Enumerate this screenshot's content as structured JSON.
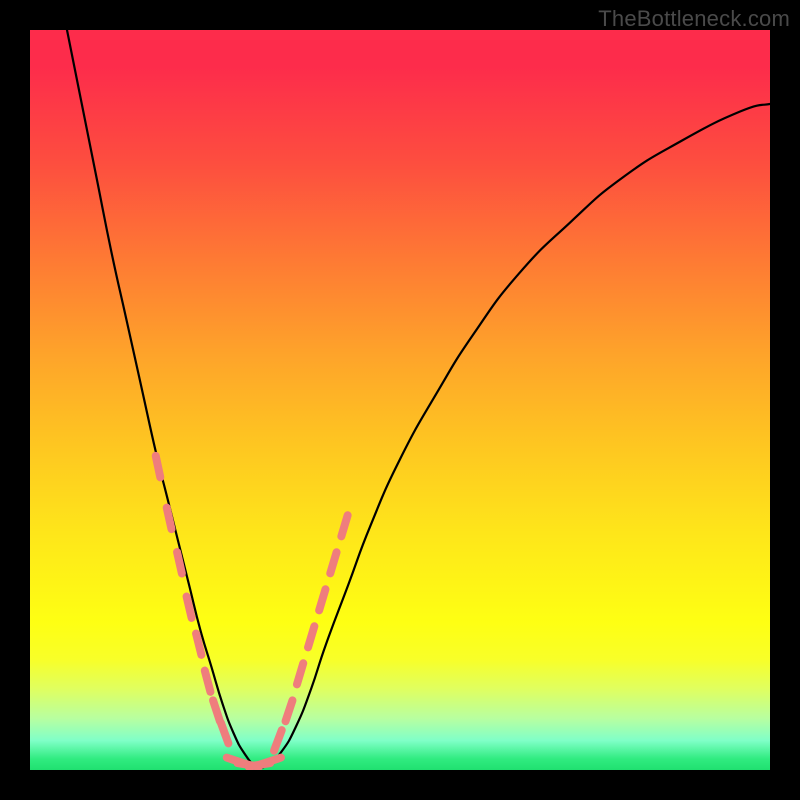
{
  "watermark": "TheBottleneck.com",
  "chart_data": {
    "type": "line",
    "title": "",
    "xlabel": "",
    "ylabel": "",
    "xlim": [
      0,
      100
    ],
    "ylim": [
      0,
      100
    ],
    "grid": false,
    "legend": false,
    "background_gradient": {
      "stops": [
        {
          "pos": 0,
          "color": "#fd2c4b"
        },
        {
          "pos": 0.18,
          "color": "#fd4e3f"
        },
        {
          "pos": 0.32,
          "color": "#fe7d33"
        },
        {
          "pos": 0.44,
          "color": "#fea42a"
        },
        {
          "pos": 0.56,
          "color": "#fec621"
        },
        {
          "pos": 0.68,
          "color": "#fee61a"
        },
        {
          "pos": 0.8,
          "color": "#feff13"
        },
        {
          "pos": 0.93,
          "color": "#b8ffa0"
        },
        {
          "pos": 1.0,
          "color": "#20e070"
        }
      ]
    },
    "series": [
      {
        "name": "bottleneck-curve",
        "stroke": "#000000",
        "stroke_width": 2.2,
        "x": [
          5,
          7,
          9,
          11,
          13,
          15,
          17,
          18.5,
          20,
          21.5,
          23,
          24.5,
          26,
          27.5,
          29,
          30.5,
          32,
          34,
          36,
          38,
          40,
          43,
          46,
          50,
          55,
          60,
          66,
          73,
          80,
          88,
          96,
          100
        ],
        "y": [
          100,
          90,
          80,
          70,
          61,
          52,
          43,
          37,
          31,
          25,
          19,
          14,
          9,
          5,
          2.2,
          0.6,
          0.6,
          2.5,
          6,
          11,
          17,
          25,
          33,
          42,
          51,
          59,
          67,
          74,
          80,
          85,
          89,
          90
        ]
      },
      {
        "name": "highlight-dashes-left",
        "stroke": "#ef7d7d",
        "stroke_width": 8,
        "dash": true,
        "x": [
          17.3,
          18.8,
          20.2,
          21.5,
          22.8,
          24.0,
          25.2,
          26.3
        ],
        "y": [
          41,
          34,
          28,
          22,
          17,
          12,
          8,
          5
        ]
      },
      {
        "name": "highlight-dashes-right",
        "stroke": "#ef7d7d",
        "stroke_width": 8,
        "dash": true,
        "x": [
          33.5,
          35.0,
          36.5,
          38.0,
          39.5,
          41.0,
          42.5
        ],
        "y": [
          4,
          8,
          13,
          18,
          23,
          28,
          33
        ]
      },
      {
        "name": "highlight-dashes-bottom",
        "stroke": "#ef7d7d",
        "stroke_width": 8,
        "dash": true,
        "x": [
          28.0,
          29.5,
          31.0,
          32.5
        ],
        "y": [
          1.2,
          0.7,
          0.7,
          1.2
        ]
      }
    ]
  }
}
